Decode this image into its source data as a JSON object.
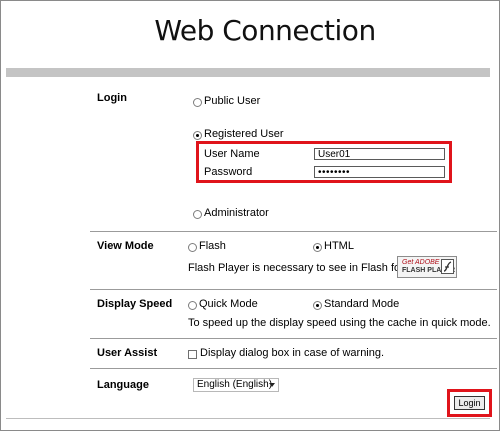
{
  "page": {
    "title": "Web Connection"
  },
  "login": {
    "label": "Login",
    "public_user": "Public User",
    "registered_user": "Registered User",
    "user_name_label": "User Name",
    "user_name_value": "User01",
    "password_label": "Password",
    "password_value": "••••••••",
    "administrator": "Administrator"
  },
  "view_mode": {
    "label": "View Mode",
    "flash": "Flash",
    "html": "HTML",
    "note": "Flash Player is necessary to see in Flash form.",
    "badge_line1": "Get ADOBE",
    "badge_line2": "FLASH PLAYER"
  },
  "display_speed": {
    "label": "Display Speed",
    "quick": "Quick Mode",
    "standard": "Standard Mode",
    "note": "To speed up the display speed using the cache in quick mode."
  },
  "user_assist": {
    "label": "User Assist",
    "checkbox_text": "Display dialog box in case of warning."
  },
  "language": {
    "label": "Language",
    "selected": "English (English)"
  },
  "actions": {
    "login_button": "Login"
  },
  "colors": {
    "highlight": "#e0141b",
    "bar": "#c4c4c4"
  }
}
